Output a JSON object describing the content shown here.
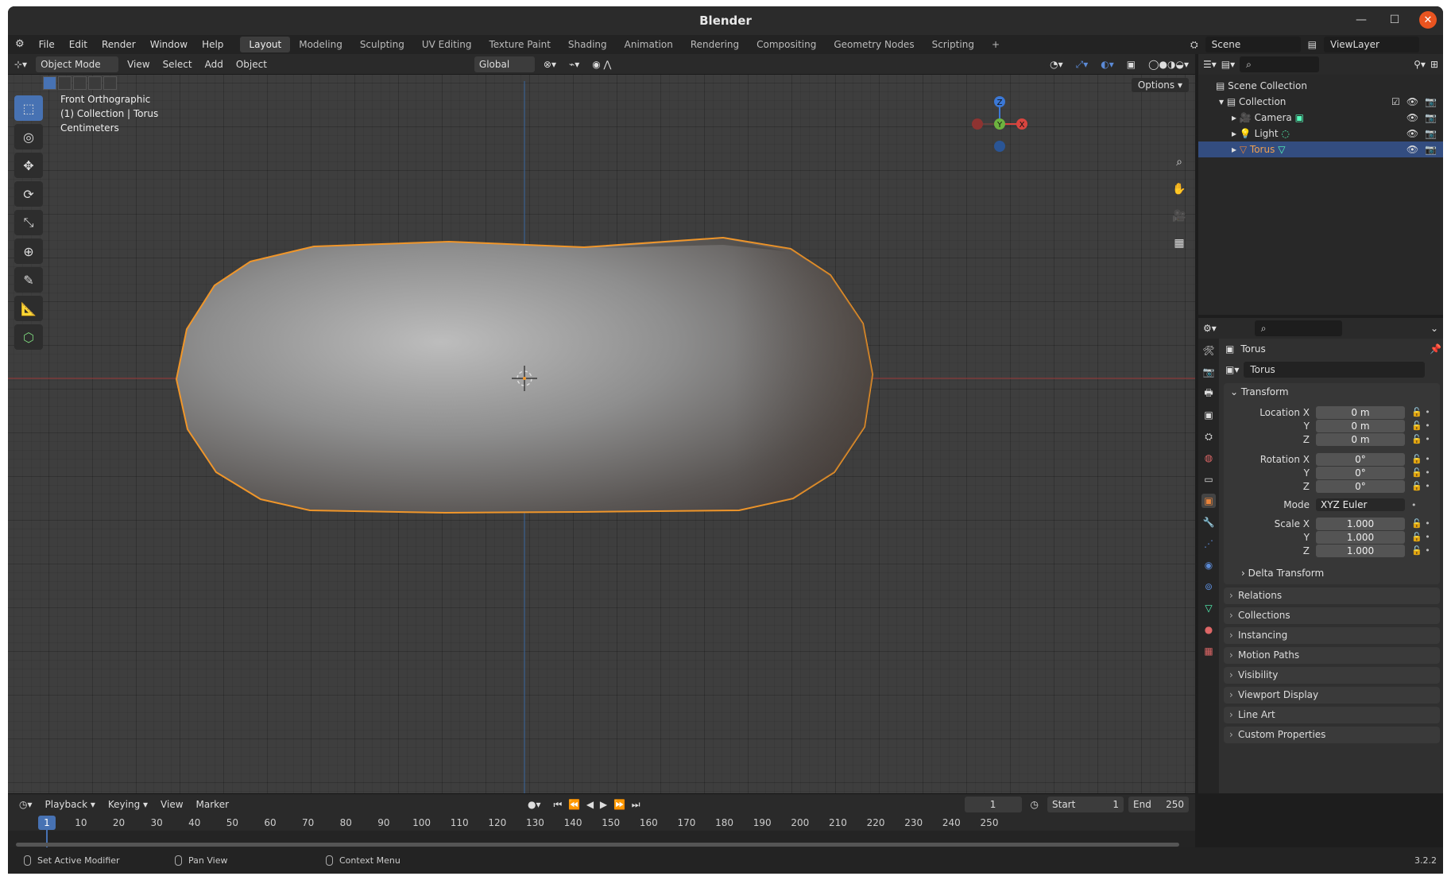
{
  "window": {
    "title": "Blender"
  },
  "menu": {
    "items": [
      "File",
      "Edit",
      "Render",
      "Window",
      "Help"
    ]
  },
  "workspaces": [
    "Layout",
    "Modeling",
    "Sculpting",
    "UV Editing",
    "Texture Paint",
    "Shading",
    "Animation",
    "Rendering",
    "Compositing",
    "Geometry Nodes",
    "Scripting"
  ],
  "topright": {
    "scene": "Scene",
    "viewlayer": "ViewLayer"
  },
  "header3d": {
    "mode": "Object Mode",
    "menus": [
      "View",
      "Select",
      "Add",
      "Object"
    ],
    "orientation": "Global"
  },
  "viewport": {
    "info": [
      "Front Orthographic",
      "(1) Collection | Torus",
      "Centimeters"
    ],
    "options": "Options",
    "axes": {
      "z": "Z",
      "y": "Y",
      "x": "X"
    }
  },
  "outliner": {
    "root": "Scene Collection",
    "collection": "Collection",
    "items": [
      "Camera",
      "Light",
      "Torus"
    ],
    "selected": "Torus"
  },
  "properties": {
    "object_name": "Torus",
    "data_name": "Torus",
    "transform_label": "Transform",
    "location": {
      "label": "Location X",
      "x": "0 m",
      "y": "0 m",
      "z": "0 m"
    },
    "rotation": {
      "label": "Rotation X",
      "x": "0°",
      "y": "0°",
      "z": "0°"
    },
    "mode": {
      "label": "Mode",
      "value": "XYZ Euler"
    },
    "scale": {
      "label": "Scale X",
      "x": "1.000",
      "y": "1.000",
      "z": "1.000"
    },
    "axis_labels": {
      "y": "Y",
      "z": "Z"
    },
    "delta": "Delta Transform",
    "panels": [
      "Relations",
      "Collections",
      "Instancing",
      "Motion Paths",
      "Visibility",
      "Viewport Display",
      "Line Art",
      "Custom Properties"
    ]
  },
  "timeline": {
    "menus": [
      "Playback",
      "Keying",
      "View",
      "Marker"
    ],
    "current": "1",
    "start_label": "Start",
    "start": "1",
    "end_label": "End",
    "end": "250",
    "ticks": [
      "1",
      "10",
      "20",
      "30",
      "40",
      "50",
      "60",
      "70",
      "80",
      "90",
      "100",
      "110",
      "120",
      "130",
      "140",
      "150",
      "160",
      "170",
      "180",
      "190",
      "200",
      "210",
      "220",
      "230",
      "240",
      "250"
    ]
  },
  "status": {
    "left": "Set Active Modifier",
    "mid": "Pan View",
    "right": "Context Menu",
    "version": "3.2.2"
  },
  "colors": {
    "accent": "#4772b3",
    "selection": "#e8833a",
    "close": "#e95420"
  }
}
